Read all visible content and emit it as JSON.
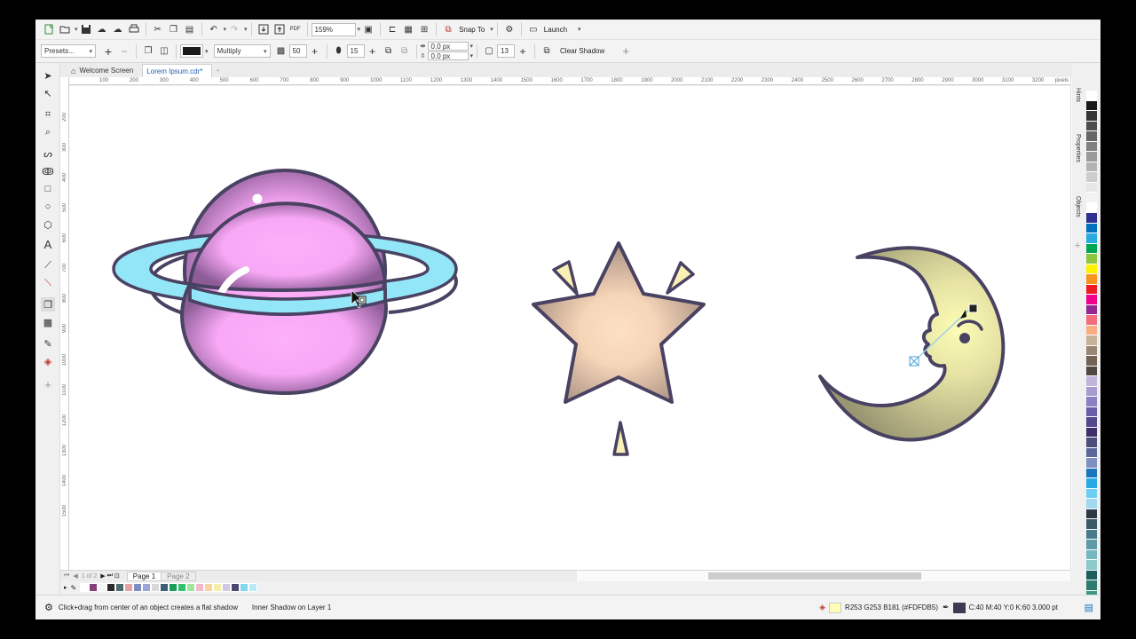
{
  "toolbar": {
    "zoom": "159%",
    "snap_to": "Snap To",
    "launch": "Launch"
  },
  "property_bar": {
    "presets": "Presets...",
    "shadow_color": "#1a1a1a",
    "merge_mode": "Multiply",
    "opacity": "50",
    "feather": "15",
    "offset_x": "0.0 px",
    "offset_y": "0.0 px",
    "spread": "13",
    "clear_shadow": "Clear Shadow"
  },
  "tabs": [
    {
      "label": "Welcome Screen"
    },
    {
      "label": "Lorem Ipsum.cdr*"
    }
  ],
  "ruler": {
    "h_ticks": [
      "100",
      "200",
      "300",
      "400",
      "500",
      "600",
      "700",
      "800",
      "900",
      "1000",
      "1100",
      "1200",
      "1300",
      "1400",
      "1500",
      "1600",
      "1700",
      "1800",
      "1900",
      "2000",
      "2100",
      "2200",
      "2300",
      "2400",
      "2500",
      "2600",
      "2700",
      "2800",
      "2900",
      "3000",
      "3100",
      "3200"
    ],
    "unit": "pixels",
    "v_ticks": [
      "200",
      "300",
      "400",
      "500",
      "600",
      "700",
      "800",
      "900",
      "1000",
      "1100",
      "1200",
      "1300",
      "1400",
      "1500"
    ]
  },
  "dock_tabs": [
    "Hints",
    "Properties",
    "Objects"
  ],
  "page_nav": {
    "counter": "1 of 2",
    "pages": [
      "Page 1",
      "Page 2"
    ]
  },
  "status": {
    "hint": "Click+drag from center of an object creates a flat shadow",
    "object_info": "Inner Shadow on Layer 1",
    "fill_swatch": "#FDFDB5",
    "fill_info": "R253 G253 B181 (#FDFDB5)",
    "outline_swatch": "#3d3a55",
    "outline_info": "C:40 M:40 Y:0 K:60  3.000 pt"
  },
  "palette_colors": [
    "#ffffff",
    "#1a1a1a",
    "#333333",
    "#4d4d4d",
    "#666666",
    "#808080",
    "#999999",
    "#b3b3b3",
    "#cccccc",
    "#e6e6e6",
    "#f2f2f2",
    "#ffffff",
    "#2e3192",
    "#0071bc",
    "#29abe2",
    "#00a651",
    "#8dc63f",
    "#fff200",
    "#f7941d",
    "#ed1c24",
    "#ec008c",
    "#92278f",
    "#f26d7d",
    "#f9ad81",
    "#c7b299",
    "#998675",
    "#736357",
    "#534741",
    "#c2b5dd",
    "#a59bd1",
    "#8c7fc4",
    "#6b5ca8",
    "#55478c",
    "#3d3068",
    "#4a4f7c",
    "#5d6899",
    "#7f8fbf",
    "#1b75bc",
    "#27aae1",
    "#6dcff6",
    "#a0d9f0",
    "#2b3a42",
    "#3a5a67",
    "#497a8a",
    "#5e9aa7",
    "#75b7bf",
    "#8cc9c9",
    "#1f5c5c",
    "#2e7b70",
    "#3f9a83",
    "#5fb89a",
    "#86cdb0",
    "#b0e0c8",
    "#2e8b57"
  ],
  "document_palette": [
    "#ffffff",
    "#8a3f7a",
    "#f5f5f5",
    "#2b2b2b",
    "#4d6a6e",
    "#e8a0a0",
    "#7b8fc4",
    "#9aa6d6",
    "#d9d9d9",
    "#3a5f7a",
    "#1b9e5a",
    "#2fc26a",
    "#9ee69e",
    "#f4b8c8",
    "#f8d4a0",
    "#f4f0a8",
    "#d2c7e8",
    "#4a4a6e",
    "#7fd8f0",
    "#b9eaf6"
  ]
}
